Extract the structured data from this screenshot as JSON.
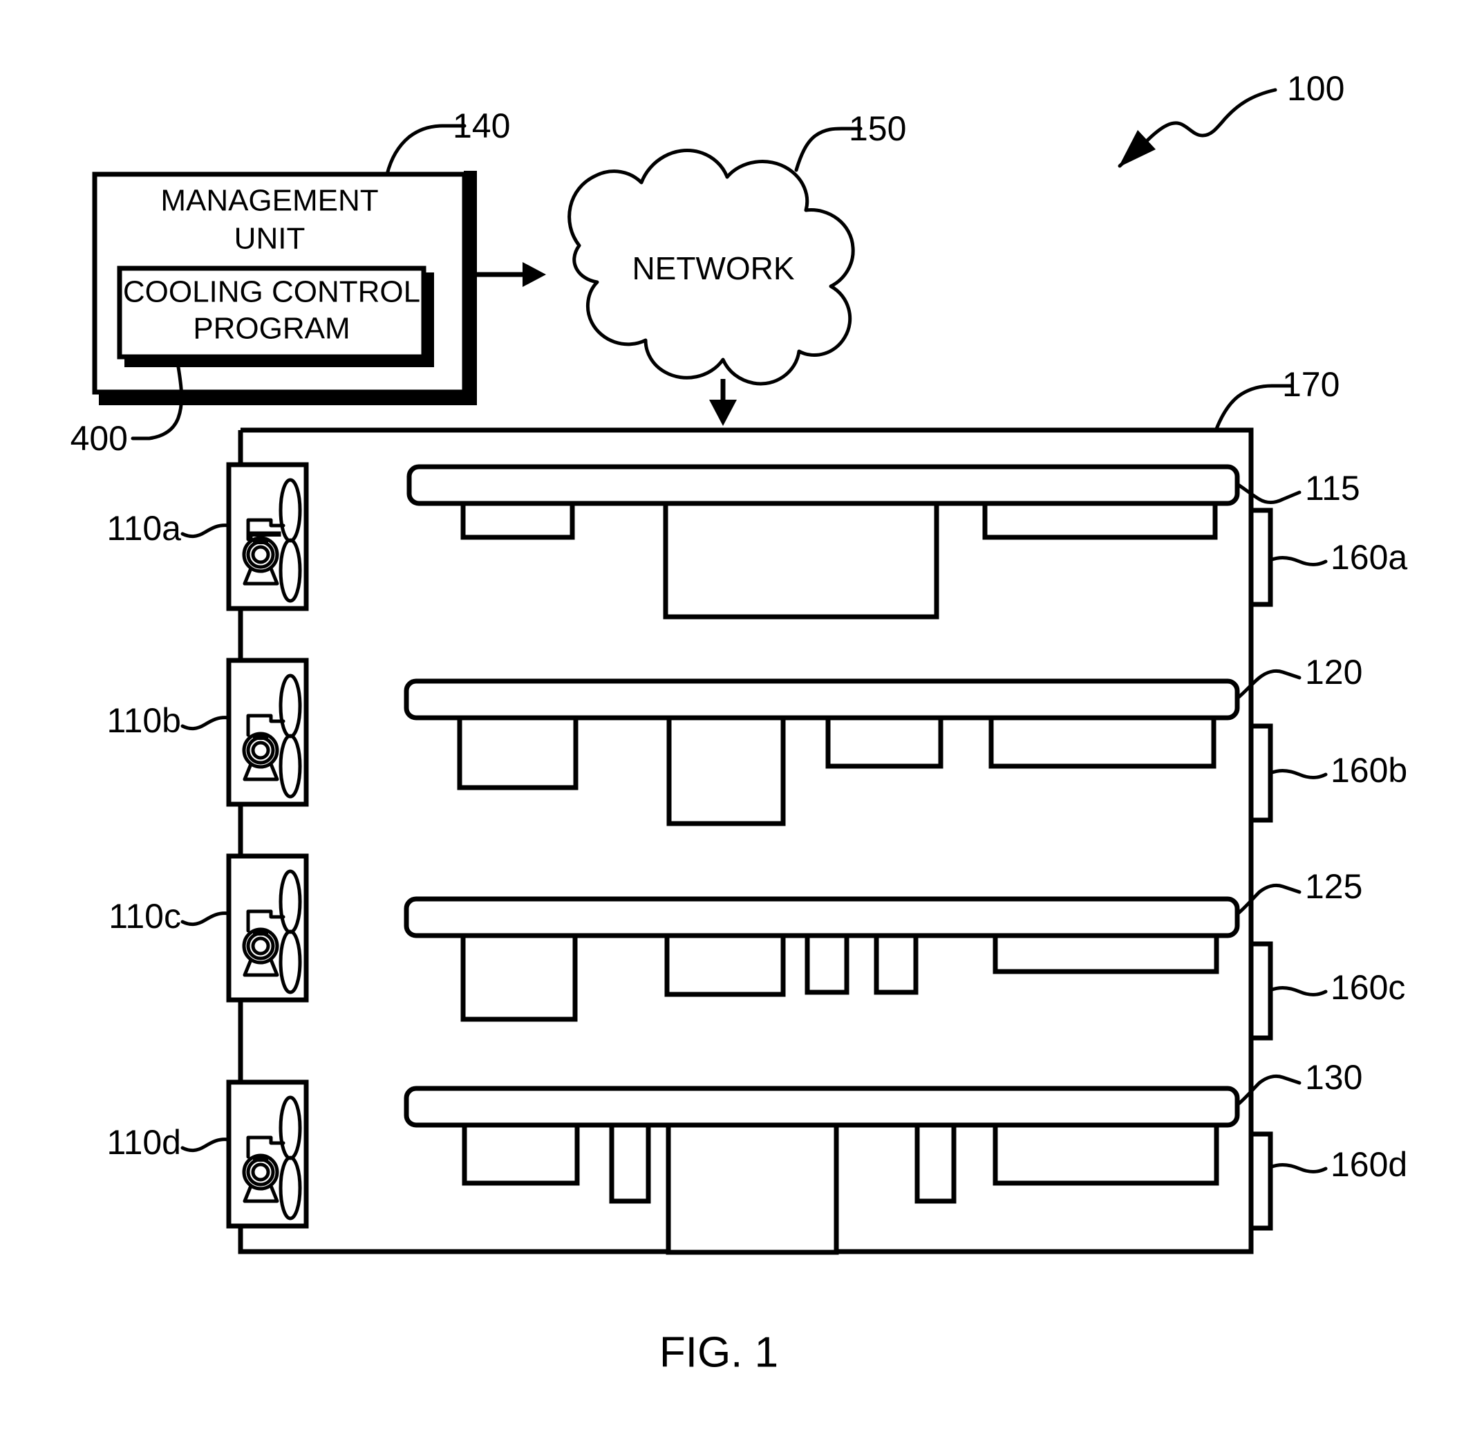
{
  "figure": {
    "caption": "FIG. 1",
    "system_ref": "100"
  },
  "management_unit": {
    "title_line1": "MANAGEMENT",
    "title_line2": "UNIT",
    "ref": "140",
    "program_line1": "COOLING CONTROL",
    "program_line2": "PROGRAM",
    "program_ref": "400"
  },
  "network": {
    "label": "NETWORK",
    "ref": "150"
  },
  "enclosure": {
    "ref": "170"
  },
  "fans": [
    {
      "ref": "110a",
      "icon": "fan-unit-icon"
    },
    {
      "ref": "110b",
      "icon": "fan-unit-icon"
    },
    {
      "ref": "110c",
      "icon": "fan-unit-icon"
    },
    {
      "ref": "110d",
      "icon": "fan-unit-icon"
    }
  ],
  "rails": [
    {
      "ref": "115"
    },
    {
      "ref": "120"
    },
    {
      "ref": "125"
    },
    {
      "ref": "130"
    }
  ],
  "connectors": [
    {
      "ref": "160a"
    },
    {
      "ref": "160b"
    },
    {
      "ref": "160c"
    },
    {
      "ref": "160d"
    }
  ],
  "colors": {
    "line": "#000000",
    "background": "#ffffff"
  }
}
